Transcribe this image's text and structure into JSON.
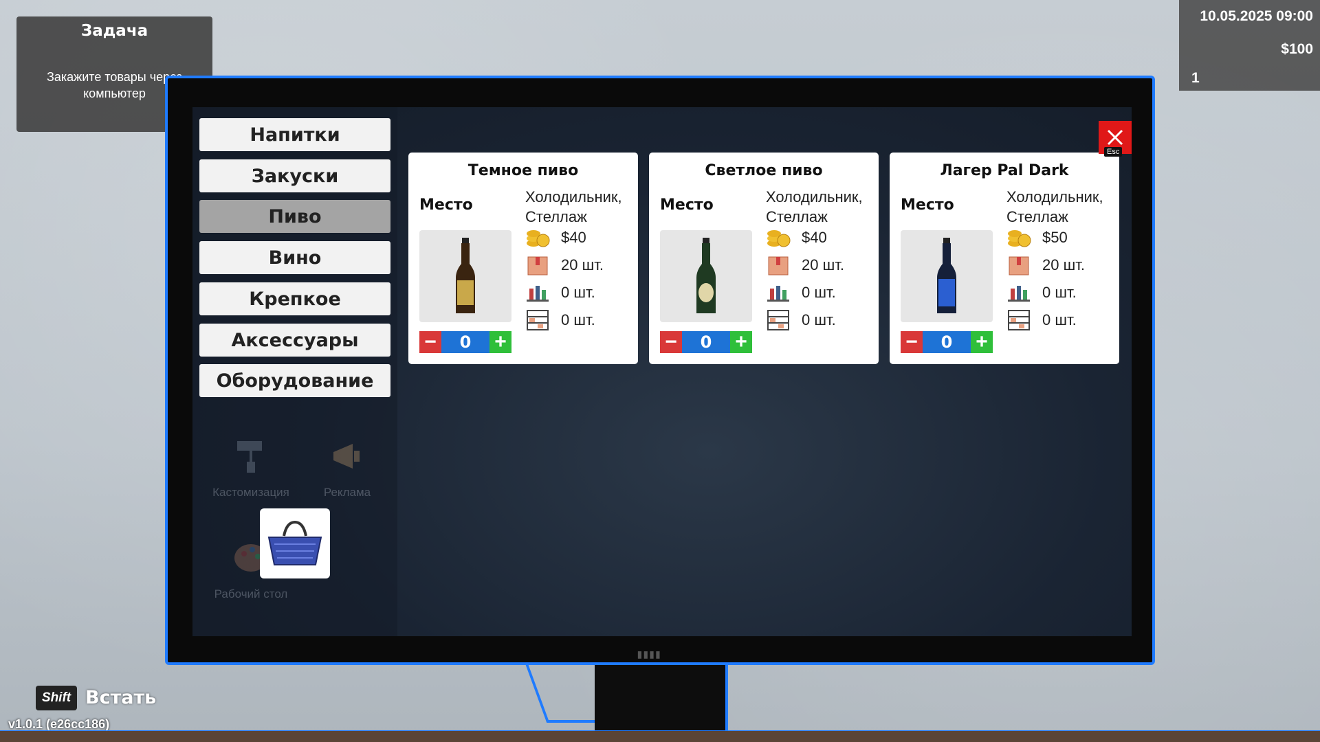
{
  "task": {
    "title": "Задача",
    "text": "Закажите товары через компьютер"
  },
  "hud": {
    "datetime": "10.05.2025 09:00",
    "money": "$100",
    "level": "1"
  },
  "sidebar": {
    "categories": [
      {
        "label": "Напитки",
        "active": false
      },
      {
        "label": "Закуски",
        "active": false
      },
      {
        "label": "Пиво",
        "active": true
      },
      {
        "label": "Вино",
        "active": false
      },
      {
        "label": "Крепкое",
        "active": false
      },
      {
        "label": "Аксессуары",
        "active": false
      },
      {
        "label": "Оборудование",
        "active": false
      }
    ],
    "background_apps": [
      {
        "label": "Кастомизация",
        "icon": "paint-roller-icon"
      },
      {
        "label": "Реклама",
        "icon": "megaphone-icon"
      },
      {
        "label": "Рабочий стол",
        "icon": "palette-icon"
      }
    ],
    "basket_icon": "shopping-basket-icon"
  },
  "products": [
    {
      "title": "Темное пиво",
      "place_label": "Место",
      "place": [
        "Холодильник,",
        "Стеллаж"
      ],
      "price": "$40",
      "box": "20 шт.",
      "fridge": "0 шт.",
      "shelf": "0 шт.",
      "qty": "0",
      "bottle_color": "#3a2410",
      "label_color": "#c9a84a"
    },
    {
      "title": "Светлое пиво",
      "place_label": "Место",
      "place": [
        "Холодильник,",
        "Стеллаж"
      ],
      "price": "$40",
      "box": "20 шт.",
      "fridge": "0 шт.",
      "shelf": "0 шт.",
      "qty": "0",
      "bottle_color": "#1f3a22",
      "label_color": "#e0d6a8"
    },
    {
      "title": "Лагер Pal Dark",
      "place_label": "Место",
      "place": [
        "Холодильник,",
        "Стеллаж"
      ],
      "price": "$50",
      "box": "20 шт.",
      "fridge": "0 шт.",
      "shelf": "0 шт.",
      "qty": "0",
      "bottle_color": "#15203a",
      "label_color": "#2b5fd1"
    }
  ],
  "close": {
    "esc_label": "Esc"
  },
  "hints": {
    "key": "Shift",
    "action": "Встать"
  },
  "version": "v1.0.1 (e26cc186)",
  "colors": {
    "accent": "#1f7bff",
    "minus": "#d93838",
    "plus": "#2fbf3a",
    "qty": "#1e73d6",
    "close": "#e01818"
  }
}
